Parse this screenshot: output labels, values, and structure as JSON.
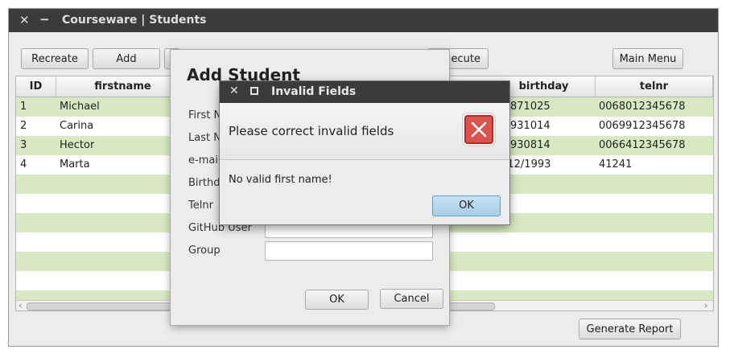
{
  "window": {
    "title": "Courseware | Students"
  },
  "toolbar": {
    "recreate": "Recreate",
    "add": "Add",
    "execute_partial": "ecute",
    "main_menu": "Main Menu"
  },
  "table": {
    "headers": {
      "id": "ID",
      "firstname": "firstname",
      "birthday": "birthday",
      "telnr": "telnr"
    },
    "rows": [
      {
        "id": "1",
        "firstname": "Michael",
        "birthday": "871025",
        "telnr": "0068012345678"
      },
      {
        "id": "2",
        "firstname": "Carina",
        "birthday": "931014",
        "telnr": "0069912345678"
      },
      {
        "id": "3",
        "firstname": "Hector",
        "birthday": "930814",
        "telnr": "0066412345678"
      },
      {
        "id": "4",
        "firstname": "Marta",
        "birthday": "/12/1993",
        "telnr": "41241"
      }
    ],
    "row_stripe_color": "#d7e9c3"
  },
  "footer": {
    "generate_report": "Generate Report"
  },
  "add_student_dialog": {
    "title": "Add Student",
    "labels": {
      "first_name": "First N",
      "last_name": "Last N",
      "email": "e-mai",
      "birthday": "Birthd",
      "telnr": "Telnr",
      "github": "GitHub User",
      "group": "Group"
    },
    "ok": "OK",
    "cancel": "Cancel"
  },
  "alert": {
    "title": "Invalid Fields",
    "header": "Please correct invalid fields",
    "content": "No valid first name!",
    "ok": "OK",
    "icon": "error-icon",
    "icon_color": "#d9534f"
  }
}
